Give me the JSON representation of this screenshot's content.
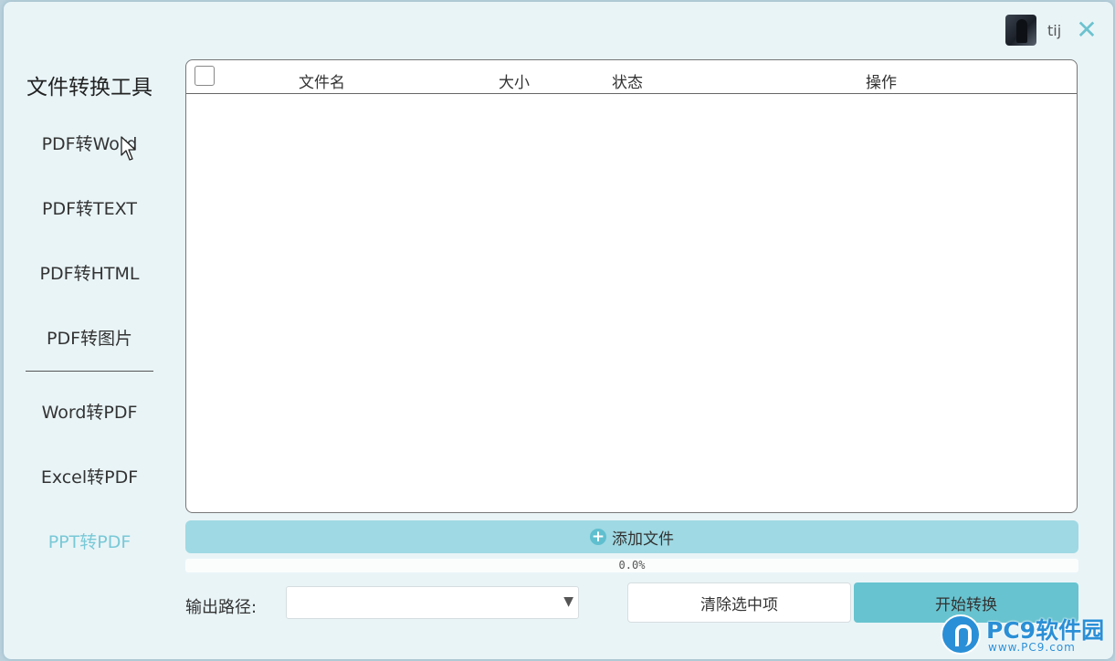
{
  "header": {
    "username": "tij",
    "close_glyph": "✕"
  },
  "sidebar": {
    "title": "文件转换工具",
    "items": [
      {
        "label": "PDF转Word",
        "active": false
      },
      {
        "label": "PDF转TEXT",
        "active": false
      },
      {
        "label": "PDF转HTML",
        "active": false
      },
      {
        "label": "PDF转图片",
        "active": false
      },
      {
        "label": "Word转PDF",
        "active": false
      },
      {
        "label": "Excel转PDF",
        "active": false
      },
      {
        "label": "PPT转PDF",
        "active": true
      }
    ]
  },
  "table": {
    "columns": [
      "文件名",
      "大小",
      "状态",
      "操作"
    ],
    "rows": []
  },
  "actions": {
    "add_files_label": "添加文件",
    "add_icon": "plus-circle-icon"
  },
  "progress": {
    "text": "0.0%",
    "value": 0.0
  },
  "output": {
    "label": "输出路径:",
    "path_value": ""
  },
  "buttons": {
    "clear_label": "清除选中项",
    "start_label": "开始转换"
  },
  "watermark": {
    "brand": "PC9软件园",
    "url": "www.PC9.com"
  },
  "colors": {
    "accent": "#67c3cf",
    "accent_light": "#9fd9e3",
    "active_nav": "#79c9d6",
    "watermark_blue": "#2a8fd6"
  }
}
